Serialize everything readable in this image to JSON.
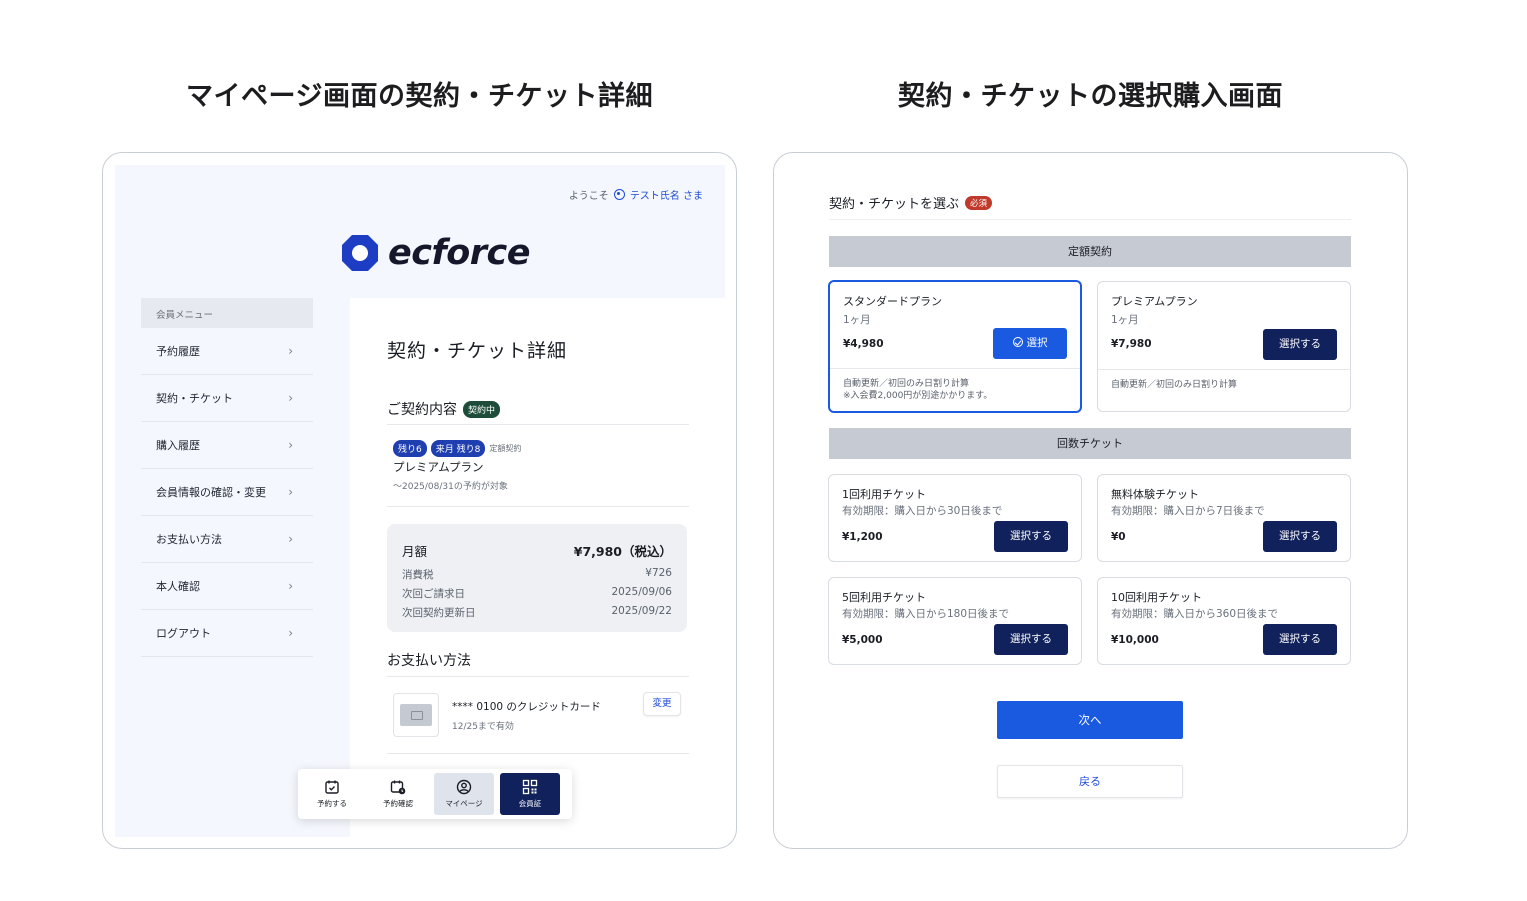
{
  "headings": {
    "left": "マイページ画面の契約・チケット詳細",
    "right": "契約・チケットの選択購入画面"
  },
  "mypage": {
    "welcome": "ようこそ",
    "user_name": "テスト氏名 さま",
    "logo_text": "ecforce",
    "menu_header": "会員メニュー",
    "menu_items": [
      {
        "label": "予約履歴"
      },
      {
        "label": "契約・チケット"
      },
      {
        "label": "購入履歴"
      },
      {
        "label": "会員情報の確認・変更"
      },
      {
        "label": "お支払い方法"
      },
      {
        "label": "本人確認"
      },
      {
        "label": "ログアウト"
      }
    ],
    "title": "契約・チケット詳細",
    "contract_section": "ご契約内容",
    "contract_status": "契約中",
    "badges": [
      "残り6",
      "来月 残り8"
    ],
    "plan_type": "定額契約",
    "plan_name": "プレミアムプラン",
    "plan_period": "〜2025/08/31の予約が対象",
    "summary": {
      "main_label": "月額",
      "main_value": "¥7,980（税込）",
      "rows": [
        {
          "label": "消費税",
          "value": "¥726"
        },
        {
          "label": "次回ご請求日",
          "value": "2025/09/06"
        },
        {
          "label": "次回契約更新日",
          "value": "2025/09/22"
        }
      ]
    },
    "payment_section": "お支払い方法",
    "card_label": "**** 0100 のクレジットカード",
    "card_expiry": "12/25まで有効",
    "change_label": "変更",
    "bottom_nav": [
      {
        "label": "予約する",
        "icon": "calendar-check-icon"
      },
      {
        "label": "予約確認",
        "icon": "calendar-clock-icon"
      },
      {
        "label": "マイページ",
        "icon": "user-circle-icon"
      },
      {
        "label": "会員証",
        "icon": "qr-code-icon"
      }
    ]
  },
  "purchase": {
    "title": "契約・チケットを選ぶ",
    "required": "必須",
    "fixed_band": "定額契約",
    "count_band": "回数チケット",
    "plans": [
      {
        "name": "スタンダードプラン",
        "sub": "1ヶ月",
        "price": "¥4,980",
        "button": "選択",
        "note1": "自動更新／初回のみ日割り計算",
        "note2": "※入会費2,000円が別途かかります。"
      },
      {
        "name": "プレミアムプラン",
        "sub": "1ヶ月",
        "price": "¥7,980",
        "button": "選択する",
        "note1": "自動更新／初回のみ日割り計算"
      }
    ],
    "tickets": [
      {
        "name": "1回利用チケット",
        "sub": "有効期限：購入日から30日後まで",
        "price": "¥1,200",
        "button": "選択する"
      },
      {
        "name": "無料体験チケット",
        "sub": "有効期限：購入日から7日後まで",
        "price": "¥0",
        "button": "選択する"
      },
      {
        "name": "5回利用チケット",
        "sub": "有効期限：購入日から180日後まで",
        "price": "¥5,000",
        "button": "選択する"
      },
      {
        "name": "10回利用チケット",
        "sub": "有効期限：購入日から360日後まで",
        "price": "¥10,000",
        "button": "選択する"
      }
    ],
    "next": "次へ",
    "back": "戻る"
  },
  "colors": {
    "primary_navy": "#10215c",
    "accent_blue": "#1a5ae0",
    "status_green": "#1d4d3a",
    "required_red": "#c0392b"
  }
}
